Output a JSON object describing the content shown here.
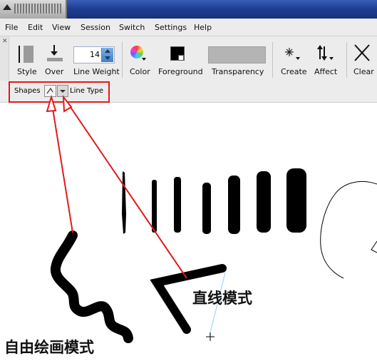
{
  "menu": [
    "File",
    "Edit",
    "View",
    "Session",
    "Switch",
    "Settings",
    "Help"
  ],
  "toolbar": {
    "style_label": "Style",
    "over_label": "Over",
    "line_weight_label": "Line Weight",
    "line_weight_value": "14",
    "color_label": "Color",
    "foreground_label": "Foreground",
    "transparency_label": "Transparency",
    "create_label": "Create",
    "affect_label": "Affect",
    "clear_label": "Clear"
  },
  "options": {
    "shapes_label": "Shapes",
    "line_type_label": "Line Type"
  },
  "annotations": {
    "freehand": "自由绘画模式",
    "straight": "直线模式"
  },
  "colors": {
    "highlight": "#e01b1b",
    "titlebar": "#1e3f94"
  },
  "icons": [
    "style-icon",
    "over-icon",
    "color-wheel-icon",
    "foreground-color-icon",
    "create-icon",
    "affect-icon",
    "clear-icon",
    "shape-icon",
    "line-type-icon",
    "crosshair-icon"
  ]
}
